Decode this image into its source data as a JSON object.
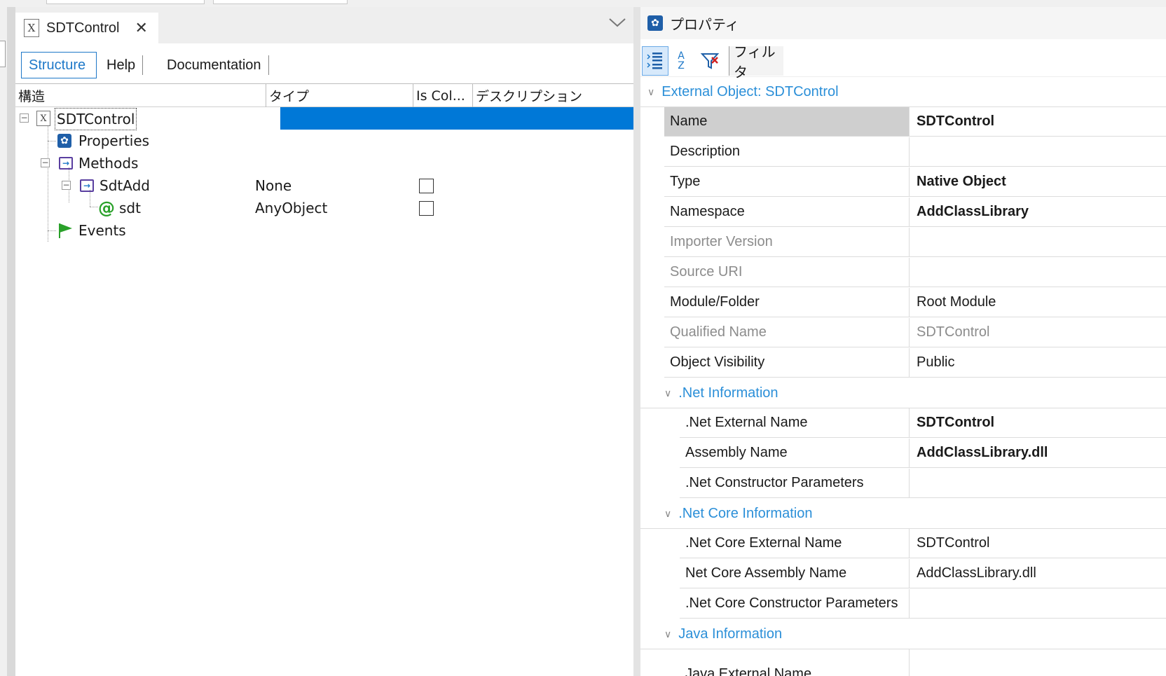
{
  "editor": {
    "tab_title": "SDTControl",
    "subtabs": {
      "structure": "Structure",
      "help": "Help",
      "documentation": "Documentation"
    },
    "columns": {
      "structure": "構造",
      "type": "タイプ",
      "is_collection": "Is Col...",
      "description": "デスクリプション"
    },
    "tree": [
      {
        "label": "SDTControl",
        "type": ""
      },
      {
        "label": "Properties",
        "type": ""
      },
      {
        "label": "Methods",
        "type": ""
      },
      {
        "label": "SdtAdd",
        "type": "None",
        "is_collection": false
      },
      {
        "label": "sdt",
        "type": "AnyObject",
        "is_collection": false
      },
      {
        "label": "Events",
        "type": ""
      }
    ]
  },
  "properties": {
    "title": "プロパティ",
    "filter_label": "フィルタ",
    "az_top": "A",
    "az_bottom": "Z",
    "section_main": "External Object: SDTControl",
    "rows": [
      {
        "name": "Name",
        "value": "SDTControl"
      },
      {
        "name": "Description",
        "value": ""
      },
      {
        "name": "Type",
        "value": "Native Object"
      },
      {
        "name": "Namespace",
        "value": "AddClassLibrary"
      },
      {
        "name": "Importer Version",
        "value": ""
      },
      {
        "name": "Source URI",
        "value": ""
      },
      {
        "name": "Module/Folder",
        "value": "Root Module"
      },
      {
        "name": "Qualified Name",
        "value": "SDTControl"
      },
      {
        "name": "Object Visibility",
        "value": "Public"
      }
    ],
    "net_section": ".Net Information",
    "net_rows": [
      {
        "name": ".Net External Name",
        "value": "SDTControl"
      },
      {
        "name": "Assembly Name",
        "value": "AddClassLibrary.dll"
      },
      {
        "name": ".Net Constructor Parameters",
        "value": ""
      }
    ],
    "netcore_section": ".Net Core Information",
    "netcore_rows": [
      {
        "name": ".Net Core External Name",
        "value": "SDTControl"
      },
      {
        "name": "Net Core Assembly Name",
        "value": "AddClassLibrary.dll"
      },
      {
        "name": ".Net Core Constructor Parameters",
        "value": ""
      }
    ],
    "java_section": "Java Information",
    "java_rows": [
      {
        "name": "Java External Name",
        "value": ""
      }
    ]
  },
  "colors": {
    "accent": "#1e78c8",
    "selection": "#0078d7",
    "category": "#2b8fd8",
    "green_icon": "#2aa12a"
  }
}
